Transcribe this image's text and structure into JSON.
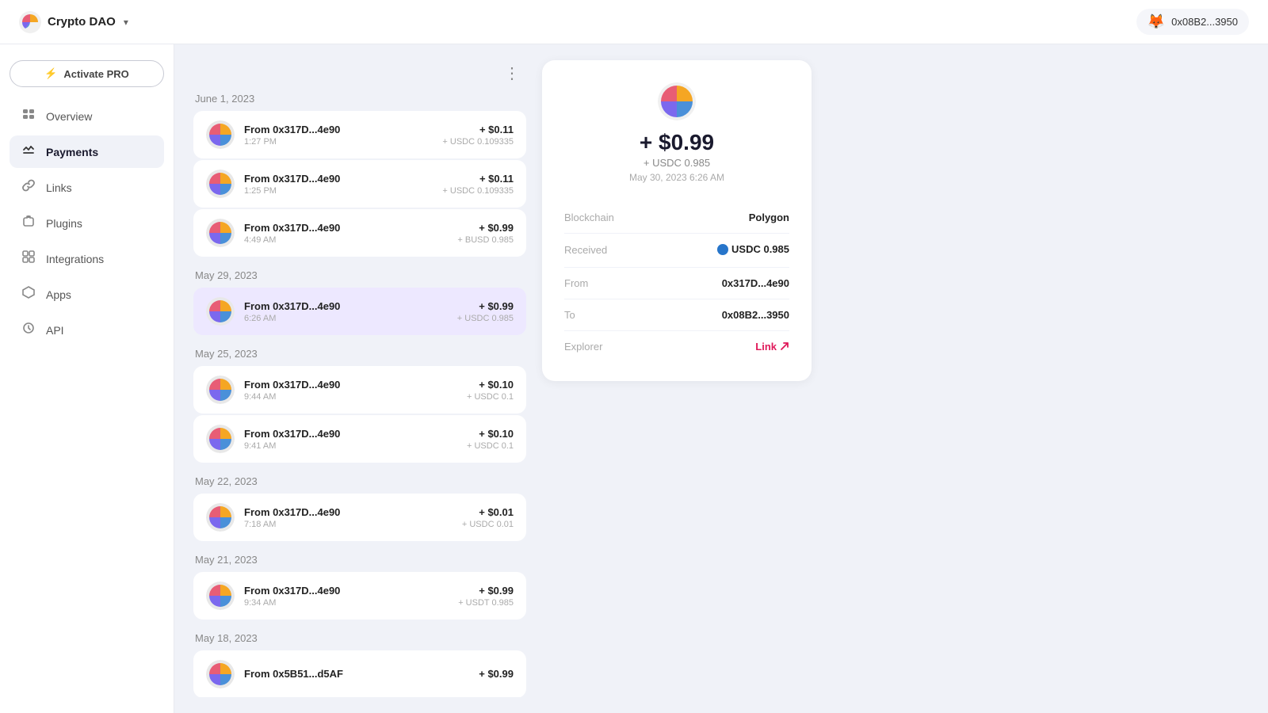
{
  "topbar": {
    "app_name": "Crypto DAO",
    "chevron": "▾",
    "wallet_emoji": "🦊",
    "wallet_address": "0x08B2...3950"
  },
  "sidebar": {
    "activate_pro_label": "Activate PRO",
    "activate_pro_icon": "⚡",
    "nav_items": [
      {
        "id": "overview",
        "label": "Overview",
        "icon": "▬"
      },
      {
        "id": "payments",
        "label": "Payments",
        "icon": "⇄",
        "active": true
      },
      {
        "id": "links",
        "label": "Links",
        "icon": "◇"
      },
      {
        "id": "plugins",
        "label": "Plugins",
        "icon": "❖"
      },
      {
        "id": "integrations",
        "label": "Integrations",
        "icon": "⧉"
      },
      {
        "id": "apps",
        "label": "Apps",
        "icon": "⬡"
      },
      {
        "id": "api",
        "label": "API",
        "icon": "↺"
      }
    ]
  },
  "transactions": {
    "more_icon": "⋮",
    "groups": [
      {
        "date": "June 1, 2023",
        "items": [
          {
            "from": "From 0x317D...4e90",
            "time": "1:27 PM",
            "amount": "+ $0.11",
            "sub": "+ USDC 0.109335"
          },
          {
            "from": "From 0x317D...4e90",
            "time": "1:25 PM",
            "amount": "+ $0.11",
            "sub": "+ USDC 0.109335"
          },
          {
            "from": "From 0x317D...4e90",
            "time": "4:49 AM",
            "amount": "+ $0.99",
            "sub": "+ BUSD 0.985"
          }
        ]
      },
      {
        "date": "May 29, 2023",
        "items": [
          {
            "from": "From 0x317D...4e90",
            "time": "6:26 AM",
            "amount": "+ $0.99",
            "sub": "+ USDC 0.985",
            "selected": true
          }
        ]
      },
      {
        "date": "May 25, 2023",
        "items": [
          {
            "from": "From 0x317D...4e90",
            "time": "9:44 AM",
            "amount": "+ $0.10",
            "sub": "+ USDC 0.1"
          },
          {
            "from": "From 0x317D...4e90",
            "time": "9:41 AM",
            "amount": "+ $0.10",
            "sub": "+ USDC 0.1"
          }
        ]
      },
      {
        "date": "May 22, 2023",
        "items": [
          {
            "from": "From 0x317D...4e90",
            "time": "7:18 AM",
            "amount": "+ $0.01",
            "sub": "+ USDC 0.01"
          }
        ]
      },
      {
        "date": "May 21, 2023",
        "items": [
          {
            "from": "From 0x317D...4e90",
            "time": "9:34 AM",
            "amount": "+ $0.99",
            "sub": "+ USDT 0.985"
          }
        ]
      },
      {
        "date": "May 18, 2023",
        "items": [
          {
            "from": "From 0x5B51...d5AF",
            "time": "",
            "amount": "+ $0.99",
            "sub": ""
          }
        ]
      }
    ]
  },
  "detail": {
    "amount_main": "+ $0.99",
    "amount_sub": "+ USDC 0.985",
    "date": "May 30, 2023 6:26 AM",
    "rows": [
      {
        "key": "Blockchain",
        "val": "Polygon",
        "type": "text"
      },
      {
        "key": "Received",
        "val": "USDC 0.985",
        "type": "usdc"
      },
      {
        "key": "From",
        "val": "0x317D...4e90",
        "type": "text"
      },
      {
        "key": "To",
        "val": "0x08B2...3950",
        "type": "text"
      },
      {
        "key": "Explorer",
        "val": "Link",
        "type": "link"
      }
    ]
  }
}
